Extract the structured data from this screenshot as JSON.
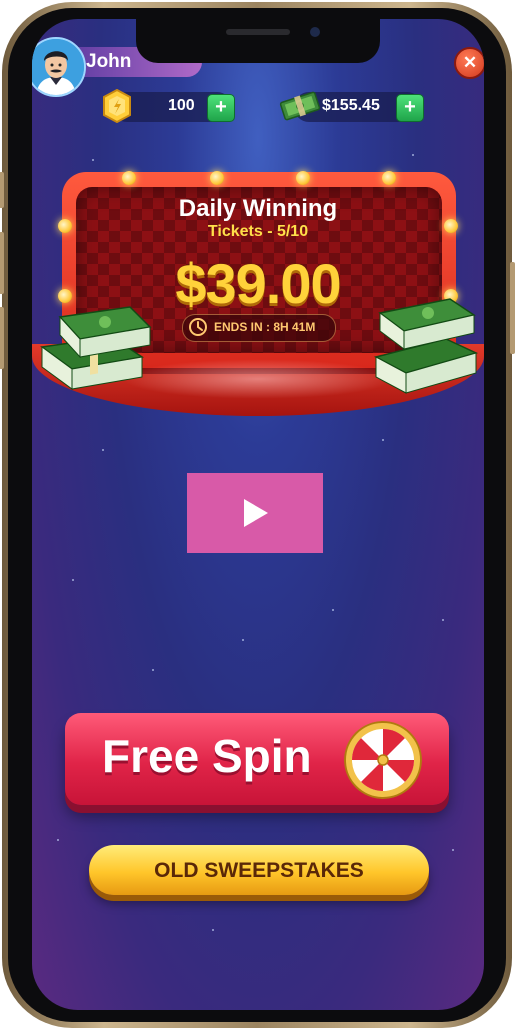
{
  "user": {
    "name": "John"
  },
  "currency": {
    "coins": "100",
    "cash": "$155.45"
  },
  "banner": {
    "title": "Daily Winning",
    "tickets": "Tickets - 5/10",
    "amount": "$39.00",
    "timer": "ENDS IN : 8H 41M"
  },
  "actions": {
    "free_spin": "Free Spin",
    "old_sweepstakes": "OLD SWEEPSTAKES"
  },
  "icons": {
    "close": "close-icon",
    "add": "plus-icon",
    "coin": "coin-icon",
    "cash": "cash-icon",
    "clock": "clock-icon",
    "play": "play-icon",
    "wheel": "prize-wheel-icon"
  },
  "colors": {
    "background": "#2c3b96",
    "banner_red": "#d8281c",
    "amount_gold": "#ffd23a",
    "spin_pink": "#e02448",
    "sweep_gold": "#ffc62a",
    "play_overlay": "#d85aa8",
    "plus_green": "#1fa44a"
  }
}
